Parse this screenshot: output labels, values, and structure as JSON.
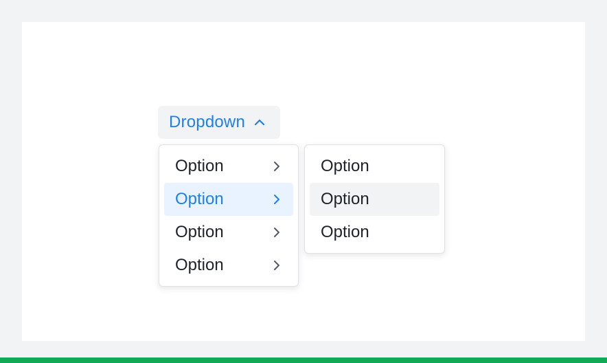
{
  "dropdown": {
    "label": "Dropdown",
    "caret_icon": "chevron-up-icon",
    "accent_color": "#1e7ff0"
  },
  "menu": {
    "items": [
      {
        "label": "Option",
        "icon": "chevron-right-icon",
        "state": "default"
      },
      {
        "label": "Option",
        "icon": "chevron-right-icon",
        "state": "active"
      },
      {
        "label": "Option",
        "icon": "chevron-right-icon",
        "state": "default"
      },
      {
        "label": "Option",
        "icon": "chevron-right-icon",
        "state": "default"
      }
    ]
  },
  "submenu": {
    "items": [
      {
        "label": "Option",
        "state": "default"
      },
      {
        "label": "Option",
        "state": "hovered"
      },
      {
        "label": "Option",
        "state": "default"
      }
    ]
  },
  "colors": {
    "page_background": "#f2f3f5",
    "canvas_background": "#ffffff",
    "bottom_bar": "#0fa958",
    "active_item_background": "#e8f3ff",
    "hovered_item_background": "#f2f3f5",
    "text": "#1d2129"
  }
}
